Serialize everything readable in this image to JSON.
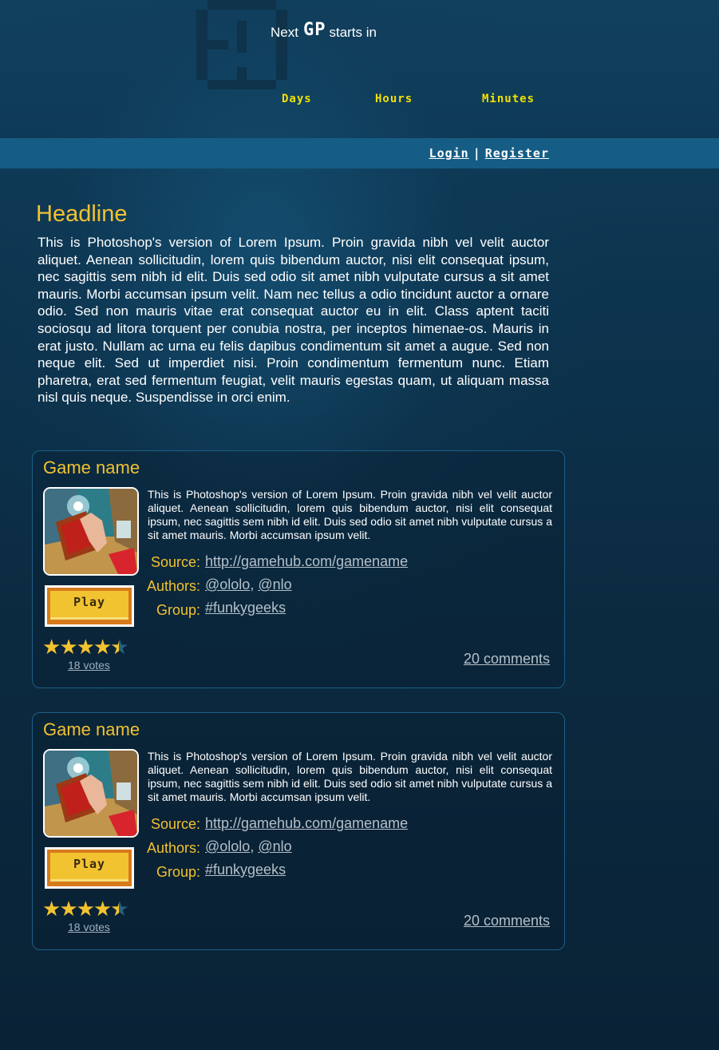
{
  "header": {
    "next_prefix": "Next",
    "gp_logo": "GP",
    "next_suffix": "starts in",
    "units": {
      "days": "Days",
      "hours": "Hours",
      "minutes": "Minutes"
    }
  },
  "nav": {
    "login": "Login",
    "separator": "|",
    "register": "Register"
  },
  "main": {
    "headline": "Headline",
    "intro": "This is Photoshop's version  of Lorem Ipsum. Proin gravida nibh vel velit auctor aliquet. Aenean sollicitudin, lorem quis bibendum auctor, nisi elit consequat ipsum, nec sagittis sem nibh id elit. Duis sed odio sit amet nibh vulputate cursus a sit amet mauris. Morbi accumsan ipsum velit. Nam nec tellus a odio tincidunt auctor a ornare odio. Sed non  mauris vitae erat consequat auctor eu in elit. Class aptent taciti sociosqu ad litora torquent per conubia nostra, per inceptos himenae-os. Mauris in erat justo. Nullam ac urna eu felis dapibus condimentum sit amet a augue. Sed non neque elit. Sed ut imperdiet nisi. Proin condimentum fermentum nunc. Etiam pharetra, erat sed fermentum feugiat, velit mauris egestas quam, ut aliquam massa nisl quis neque. Suspendisse in orci enim."
  },
  "games": [
    {
      "title": "Game name",
      "description": "This is Photoshop's version  of Lorem Ipsum. Proin gravida nibh vel velit auctor aliquet. Aenean sollicitudin, lorem quis bibendum auctor, nisi elit consequat ipsum, nec sagittis sem nibh id elit. Duis sed odio sit amet nibh vulputate cursus a sit amet mauris. Morbi accumsan ipsum velit.",
      "play_label": "Play",
      "rating": 4.5,
      "votes": "18 votes",
      "source_label": "Source:",
      "source_url": "http://gamehub.com/gamename",
      "authors_label": "Authors:",
      "author_1": "@ololo",
      "author_sep": ",",
      "author_2": "@nlo",
      "group_label": "Group:",
      "group": "#funkygeeks",
      "comments": "20 comments"
    },
    {
      "title": "Game name",
      "description": "This is Photoshop's version  of Lorem Ipsum. Proin gravida nibh vel velit auctor aliquet. Aenean sollicitudin, lorem quis bibendum auctor, nisi elit consequat ipsum, nec sagittis sem nibh id elit. Duis sed odio sit amet nibh vulputate cursus a sit amet mauris. Morbi accumsan ipsum velit.",
      "play_label": "Play",
      "rating": 4.5,
      "votes": "18 votes",
      "source_label": "Source:",
      "source_url": "http://gamehub.com/gamename",
      "authors_label": "Authors:",
      "author_1": "@ololo",
      "author_sep": ",",
      "author_2": "@nlo",
      "group_label": "Group:",
      "group": "#funkygeeks",
      "comments": "20 comments"
    }
  ],
  "colors": {
    "accent_yellow": "#f2c230",
    "timer_yellow": "#f2e000",
    "navbar": "#155d85",
    "background": "#0b2a40",
    "link_grey": "#b4c0c9"
  },
  "icons": {
    "clock": "pixel-clock-icon",
    "star": "star-icon",
    "thumbnail": "game-thumbnail"
  }
}
